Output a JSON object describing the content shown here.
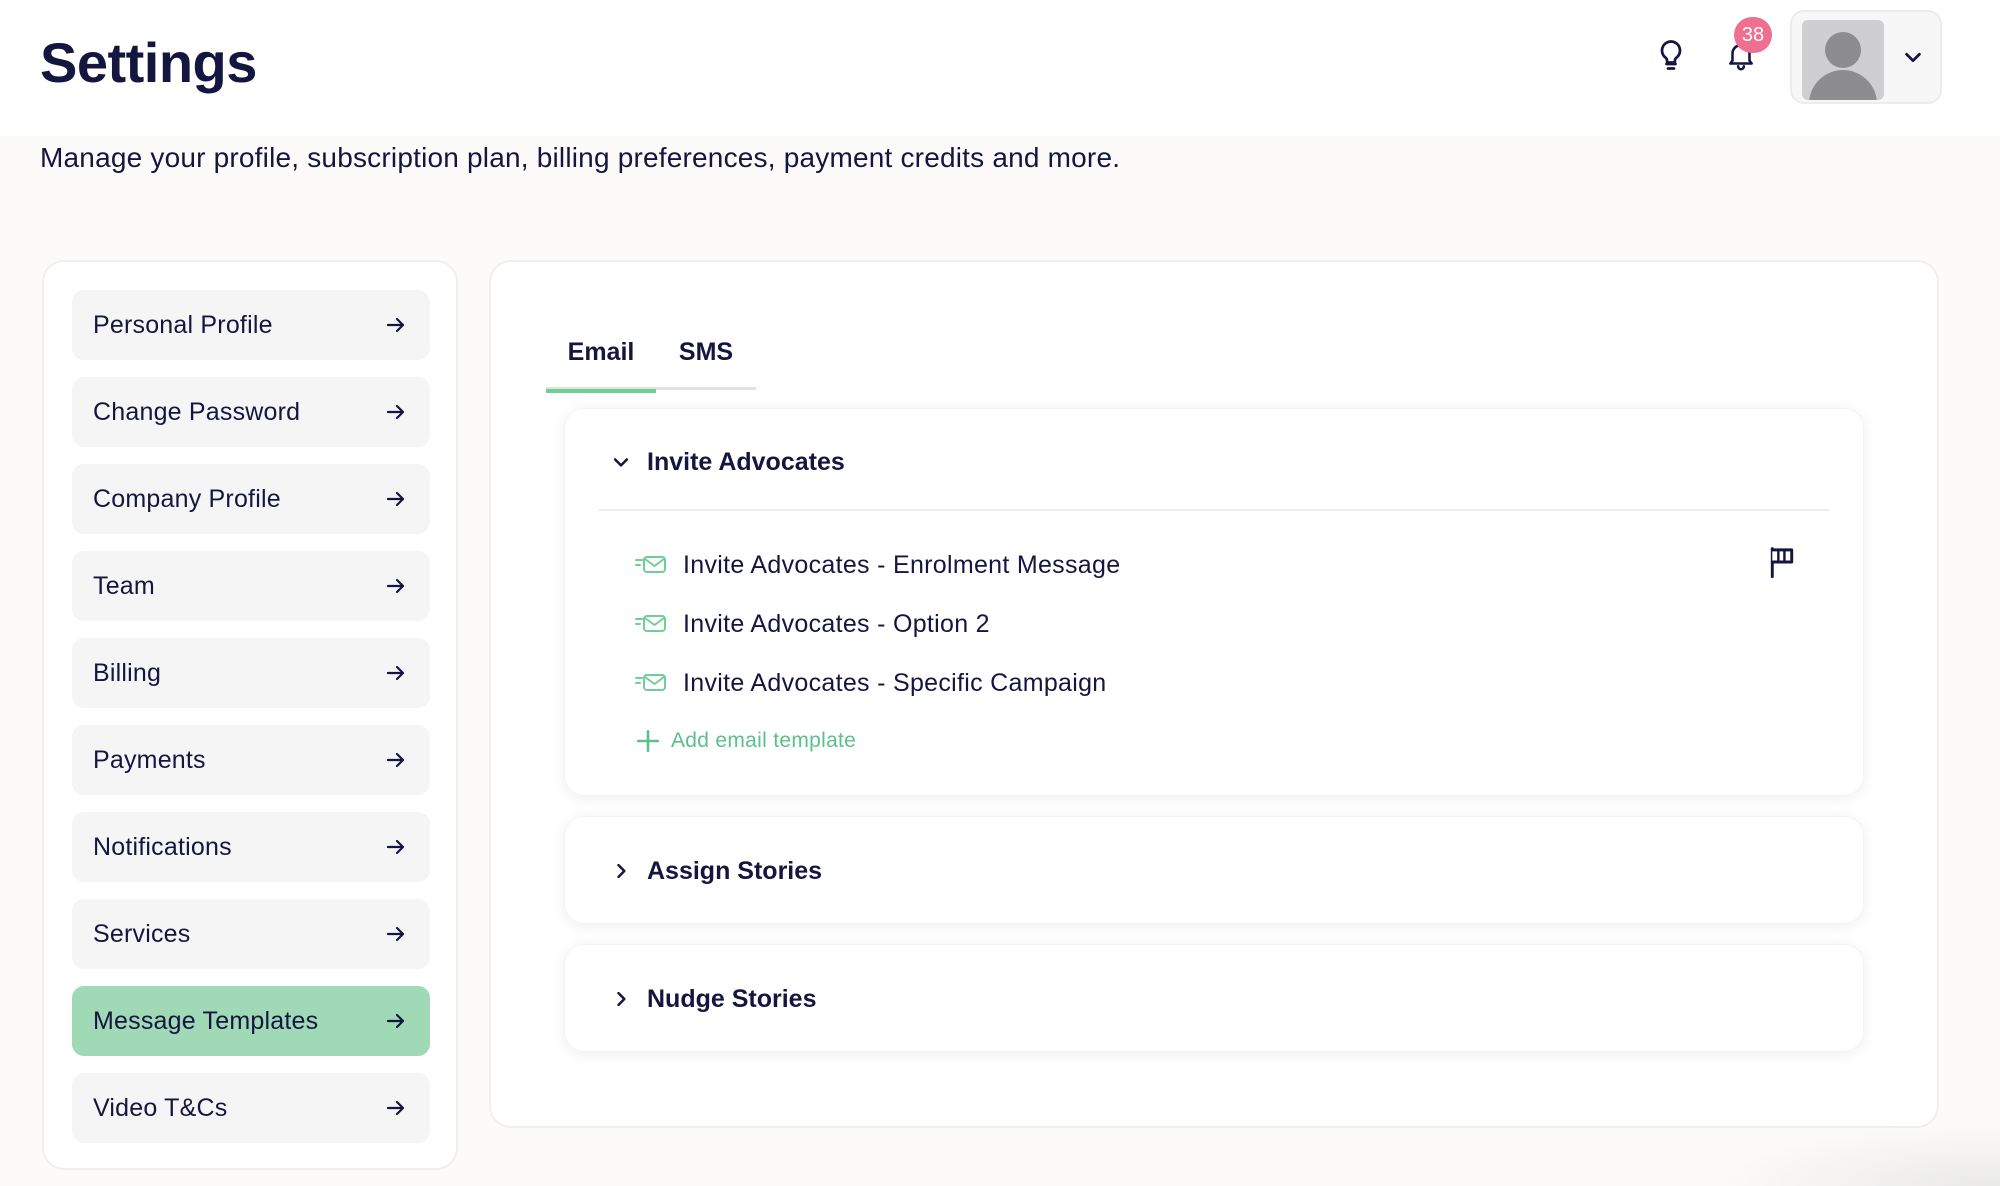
{
  "header": {
    "title": "Settings",
    "subtitle": "Manage your profile, subscription plan, billing preferences, payment credits and more.",
    "notification_count": "38",
    "icons": [
      "lightbulb-icon",
      "bell-icon",
      "avatar",
      "chevron-down-icon"
    ]
  },
  "sidebar": {
    "items": [
      {
        "label": "Personal Profile",
        "active": false
      },
      {
        "label": "Change Password",
        "active": false
      },
      {
        "label": "Company Profile",
        "active": false
      },
      {
        "label": "Team",
        "active": false
      },
      {
        "label": "Billing",
        "active": false
      },
      {
        "label": "Payments",
        "active": false
      },
      {
        "label": "Notifications",
        "active": false
      },
      {
        "label": "Services",
        "active": false
      },
      {
        "label": "Message Templates",
        "active": true
      },
      {
        "label": "Video T&Cs",
        "active": false
      }
    ]
  },
  "tabs": [
    {
      "label": "Email",
      "active": true
    },
    {
      "label": "SMS",
      "active": false
    }
  ],
  "sections": [
    {
      "title": "Invite Advocates",
      "expanded": true,
      "templates": [
        "Invite Advocates - Enrolment Message",
        "Invite Advocates - Option 2",
        "Invite Advocates - Specific Campaign"
      ],
      "add_label": "Add email template"
    },
    {
      "title": "Assign Stories",
      "expanded": false
    },
    {
      "title": "Nudge Stories",
      "expanded": false
    }
  ],
  "colors": {
    "navy": "#14163f",
    "accent_green": "#9fd9b5",
    "link_green": "#5cc08a",
    "badge_pink": "#ee6f8f"
  }
}
